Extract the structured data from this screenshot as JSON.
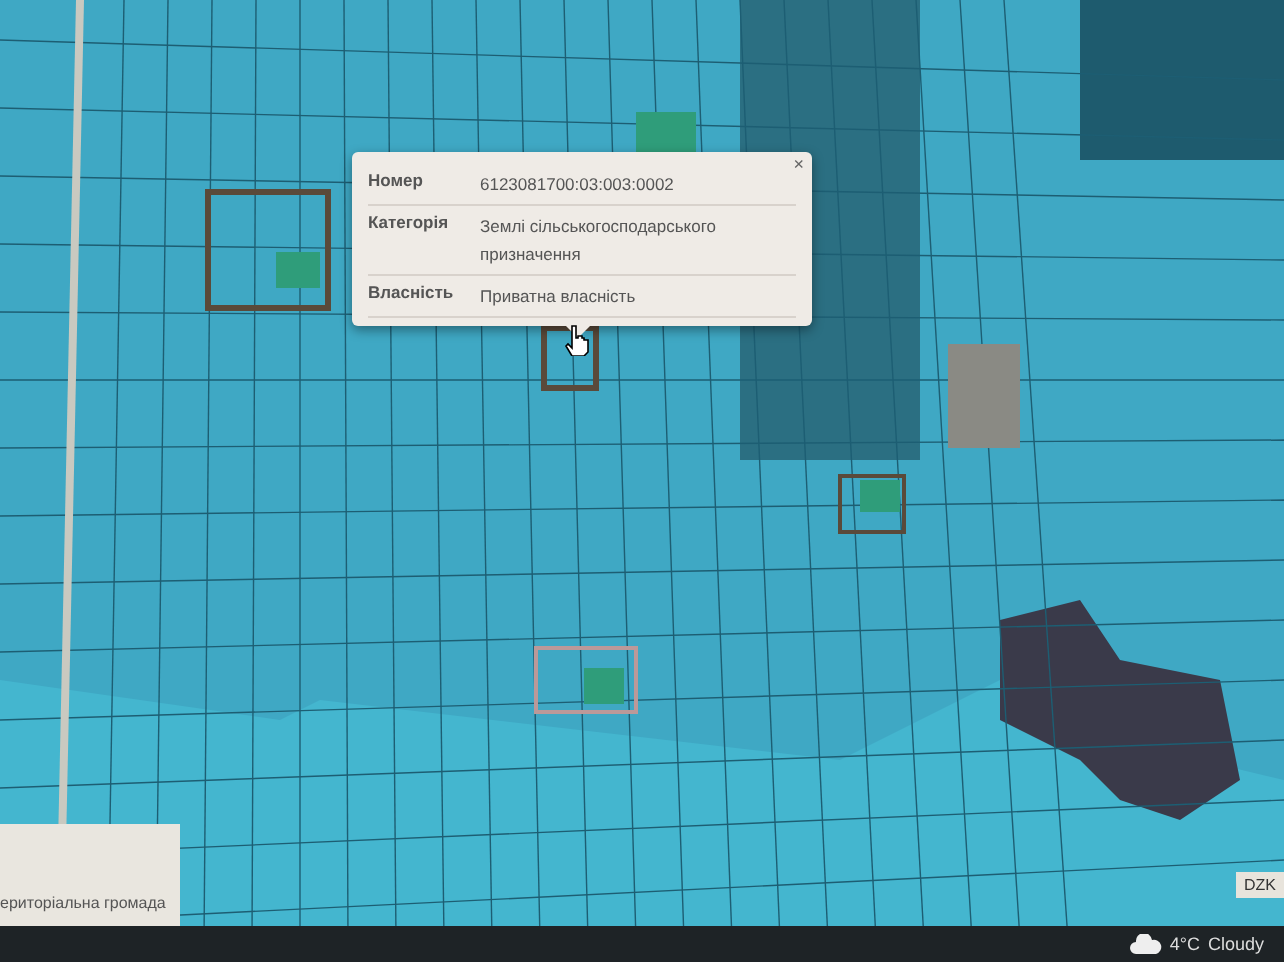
{
  "popup": {
    "close": "×",
    "rows": [
      {
        "label": "Номер",
        "value": "6123081700:03:003:0002"
      },
      {
        "label": "Категорія",
        "value": "Землі сільськогосподарського призначення"
      },
      {
        "label": "Власність",
        "value": "Приватна власність"
      }
    ]
  },
  "info_panel": {
    "text": "ериторіальна громада"
  },
  "map_badge": "DZK",
  "taskbar": {
    "temperature": "4°C",
    "condition": "Cloudy"
  }
}
